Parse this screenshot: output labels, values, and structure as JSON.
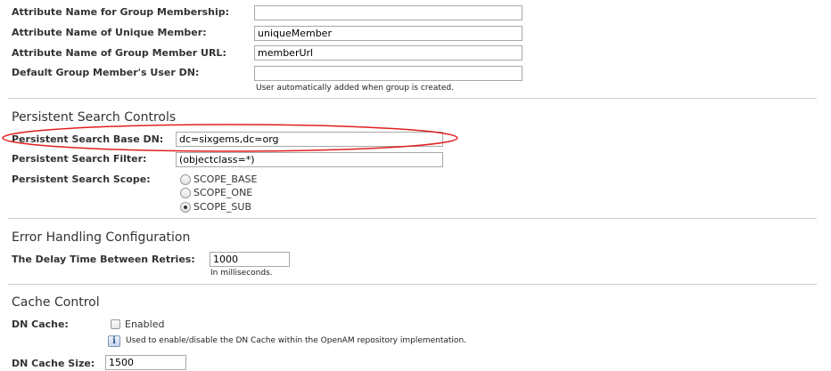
{
  "group_fields": {
    "membership_label": "Attribute Name for Group Membership:",
    "membership_value": "",
    "unique_member_label": "Attribute Name of Unique Member:",
    "unique_member_value": "uniqueMember",
    "member_url_label": "Attribute Name of Group Member URL:",
    "member_url_value": "memberUrl",
    "default_member_label": "Default Group Member's User DN:",
    "default_member_value": "",
    "default_member_help": "User automatically added when group is created."
  },
  "persistent_search": {
    "heading": "Persistent Search Controls",
    "base_dn_label": "Persistent Search Base DN:",
    "base_dn_value": "dc=sixgems,dc=org",
    "filter_label": "Persistent Search Filter:",
    "filter_value": "(objectclass=*)",
    "scope_label": "Persistent Search Scope:",
    "scope_options": [
      "SCOPE_BASE",
      "SCOPE_ONE",
      "SCOPE_SUB"
    ],
    "scope_selected": "SCOPE_SUB",
    "highlight_color": "#e0201e"
  },
  "error_handling": {
    "heading": "Error Handling Configuration",
    "delay_label": "The Delay Time Between Retries:",
    "delay_value": "1000",
    "delay_help": "In milliseconds."
  },
  "cache_control": {
    "heading": "Cache Control",
    "dn_cache_label": "DN Cache:",
    "dn_cache_checkbox_label": "Enabled",
    "dn_cache_checked": false,
    "dn_cache_help": "Used to enable/disable the DN Cache within the OpenAM repository implementation.",
    "info_icon": "info-icon",
    "cache_size_label": "DN Cache Size:",
    "cache_size_value": "1500"
  }
}
